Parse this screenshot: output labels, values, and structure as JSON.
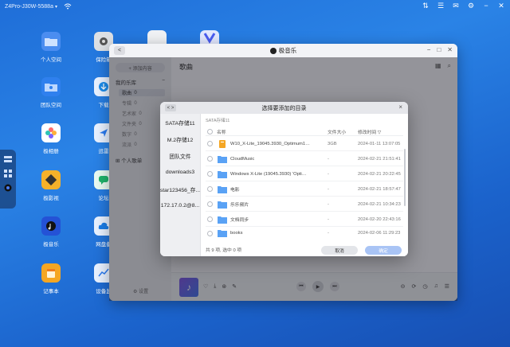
{
  "topbar": {
    "device": "Z4Pro-J30W-5588a",
    "device_chevron": "▾",
    "icons": [
      "pin-icon",
      "tray-icon",
      "message-icon",
      "gear-icon",
      "minus-icon",
      "close-icon"
    ]
  },
  "desktop": {
    "icons": [
      {
        "label": "个人空间",
        "icon": "folder-icon",
        "color": "#3f7fe8"
      },
      {
        "label": "团队空间",
        "icon": "team-folder-icon",
        "color": "#2f80ee"
      },
      {
        "label": "极相册",
        "icon": "album-icon",
        "color": "#ff6a6a"
      },
      {
        "label": "极影视",
        "icon": "video-icon",
        "color": "#f5b12a"
      },
      {
        "label": "极音乐",
        "icon": "music-icon",
        "color": "#2f5fe8"
      },
      {
        "label": "记事本",
        "icon": "notepad-icon",
        "color": "#f5a623"
      },
      {
        "label": "保险箱",
        "icon": "safe-icon",
        "color": "#9aa0a8"
      },
      {
        "label": "下载",
        "icon": "download-icon",
        "color": "#1c8bea"
      },
      {
        "label": "迅雷",
        "icon": "thunder-icon",
        "color": "#2b7bf0"
      },
      {
        "label": "论坛",
        "icon": "forum-icon",
        "color": "#1eb36b"
      },
      {
        "label": "网盘备",
        "icon": "cloud-icon",
        "color": "#1a7de8"
      },
      {
        "label": "设备监",
        "icon": "monitor-icon",
        "color": "#2b7bf0"
      }
    ]
  },
  "music_window": {
    "title": "极音乐",
    "back": "<",
    "add_button": "+ 添加内容",
    "my_library": "我的乐库",
    "library_rows": [
      {
        "label": "歌曲",
        "count": "0"
      },
      {
        "label": "专辑",
        "count": "0"
      },
      {
        "label": "艺术家",
        "count": "0"
      },
      {
        "label": "文件夹",
        "count": "0"
      },
      {
        "label": "数字",
        "count": "0"
      },
      {
        "label": "流派",
        "count": "0"
      }
    ],
    "my_playlist": "个人歌单",
    "settings": "设置",
    "main_title": "歌曲"
  },
  "dialog": {
    "title": "选择要添加的目录",
    "back": "< >",
    "close": "×",
    "sidebar": [
      "SATA存储11",
      "M.2存储12",
      "团队文件",
      "downloads3",
      "star123456_存...",
      "172.17.0.2@8..."
    ],
    "breadcrumb": "SATA存储11",
    "columns": {
      "name": "名称",
      "size": "文件大小",
      "date": "修改时间 ▽"
    },
    "rows": [
      {
        "name": "W10_X-Lite_19045.3930_Optimum10Pr...",
        "size": "3GB",
        "date": "2024-01-11 13:07:05",
        "type": "file"
      },
      {
        "name": "CloudMusic",
        "size": "-",
        "date": "2024-02-21 21:51:41",
        "type": "folder"
      },
      {
        "name": "Windows X-Lite (19045.3930) 'Optimum...",
        "size": "-",
        "date": "2024-02-21 20:22:45",
        "type": "folder"
      },
      {
        "name": "电影",
        "size": "-",
        "date": "2024-02-21 18:57:47",
        "type": "folder"
      },
      {
        "name": "乐乐频片",
        "size": "-",
        "date": "2024-02-21 10:34:23",
        "type": "folder"
      },
      {
        "name": "文档同步",
        "size": "-",
        "date": "2024-02-20 22:43:16",
        "type": "folder"
      },
      {
        "name": "books",
        "size": "-",
        "date": "2024-02-06 11:29:23",
        "type": "folder"
      }
    ],
    "count_text": "共 9 项, 选中 0 项",
    "cancel": "取消",
    "ok": "确定"
  }
}
